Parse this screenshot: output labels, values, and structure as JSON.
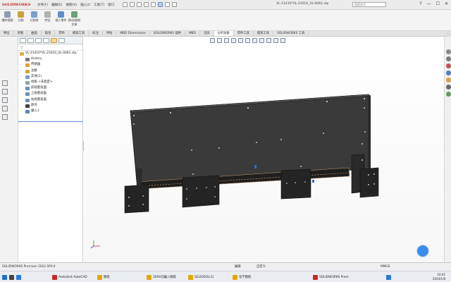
{
  "app": {
    "logo_text": "SOLIDWORKS",
    "menu": [
      "文件(F)",
      "编辑(E)",
      "视图(V)",
      "插入(I)",
      "工具(T)",
      "窗口"
    ],
    "document_title": "VL-21410*VL-21010_VL-0061.stp",
    "search_placeholder": "搜索命令",
    "window_controls": [
      "?",
      "—",
      "☐",
      "✕"
    ]
  },
  "ribbon": {
    "buttons": [
      {
        "l1": "爆炸视图",
        "l2": "",
        "icon": "explode-icon",
        "color": "#8e9ab0"
      },
      {
        "l1": "分割",
        "l2": "",
        "icon": "split-icon",
        "color": "#c9a23a"
      },
      {
        "l1": "分割线",
        "l2": "",
        "icon": "split-line-icon",
        "color": "#7aa0c8"
      },
      {
        "l1": "特征",
        "l2": "",
        "icon": "feature-icon",
        "color": "#b0b0b0"
      },
      {
        "l1": "插入零件",
        "l2": "",
        "icon": "insert-part-icon",
        "color": "#5f8fc8"
      },
      {
        "l1": "移动/复制",
        "l2": "实体",
        "icon": "move-copy-icon",
        "color": "#6aa07a"
      }
    ]
  },
  "tabs": [
    "特征",
    "草图",
    "曲面",
    "钣金",
    "焊件",
    "模具工具",
    "标注",
    "评估",
    "MBD Dimensions",
    "SOLIDWORKS 插件",
    "MBD",
    "渲染",
    "分析准备",
    "焊件工具",
    "模具工具",
    "SOLIDWORKS 工具"
  ],
  "active_tab": "分析准备",
  "tree": {
    "root": "VL-21410*VL-21010_VL-0061.stp",
    "items": [
      {
        "label": "History",
        "indent": 1,
        "icon": "history-icon",
        "color": "#7a7a7a"
      },
      {
        "label": "传感器",
        "indent": 1,
        "icon": "sensor-icon",
        "color": "#e0a030"
      },
      {
        "label": "注解",
        "indent": 1,
        "icon": "annotation-icon",
        "color": "#d0a040"
      },
      {
        "label": "实体(1)",
        "indent": 1,
        "icon": "solid-bodies-icon",
        "color": "#7a9cc0"
      },
      {
        "label": "材质 <未指定>",
        "indent": 1,
        "icon": "material-icon",
        "color": "#8fa0a8"
      },
      {
        "label": "前视基准面",
        "indent": 1,
        "icon": "plane-icon",
        "color": "#6b8fb8"
      },
      {
        "label": "上视基准面",
        "indent": 1,
        "icon": "plane-icon",
        "color": "#6b8fb8"
      },
      {
        "label": "右视基准面",
        "indent": 1,
        "icon": "plane-icon",
        "color": "#6b8fb8"
      },
      {
        "label": "原点",
        "indent": 1,
        "icon": "origin-icon",
        "color": "#404040"
      },
      {
        "label": "输入1",
        "indent": 1,
        "icon": "import-icon",
        "color": "#5b86c0"
      }
    ]
  },
  "status": {
    "product": "SOLIDWORKS Premium 2022 SP0.0",
    "center_left": "编辑",
    "center_right": "自定义",
    "right": "MMGS"
  },
  "taskbar": {
    "items": [
      {
        "label": "",
        "color": "#1e6fd0"
      },
      {
        "label": "",
        "color": "#444444"
      },
      {
        "label": "",
        "color": "#2a7ad8"
      },
      {
        "label": "Autodesk AutoCAD",
        "color": "#c82828"
      },
      {
        "label": "图纸",
        "color": "#e0a800"
      },
      {
        "label": "20XX已编入图纸",
        "color": "#e0a800"
      },
      {
        "label": "QG2DG0L(1)",
        "color": "#e0a800"
      },
      {
        "label": "化学图纸",
        "color": "#e0a800"
      },
      {
        "label": "SOLIDWORKS Prem",
        "color": "#c82828"
      },
      {
        "label": "",
        "color": "#2a7ad8"
      }
    ],
    "time": "10:41",
    "date": "2024/1/8"
  }
}
